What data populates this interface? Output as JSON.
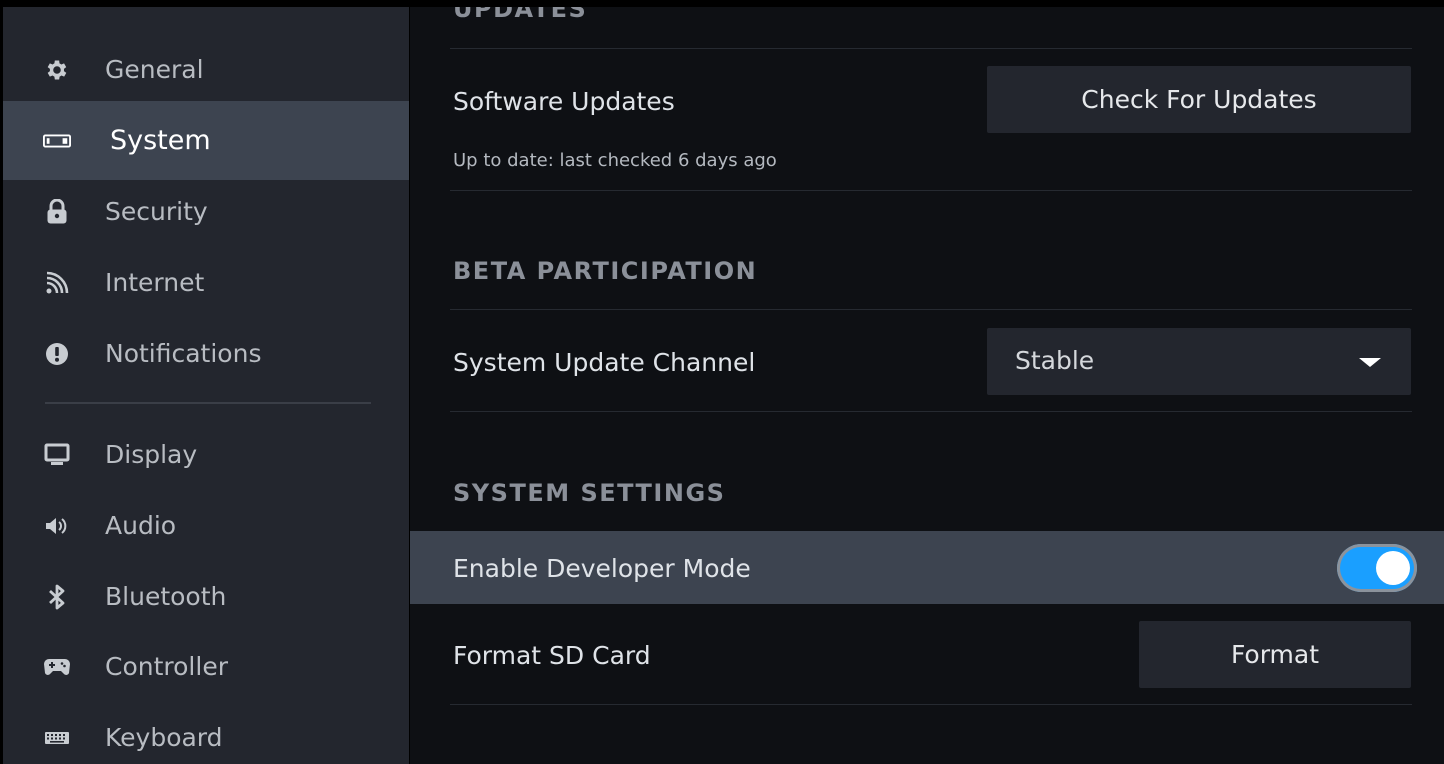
{
  "sidebar": {
    "items": [
      {
        "label": "General",
        "icon": "gear-icon",
        "active": false
      },
      {
        "label": "System",
        "icon": "system-icon",
        "active": true
      },
      {
        "label": "Security",
        "icon": "lock-icon",
        "active": false
      },
      {
        "label": "Internet",
        "icon": "wifi-icon",
        "active": false
      },
      {
        "label": "Notifications",
        "icon": "alert-icon",
        "active": false
      },
      {
        "label": "Display",
        "icon": "monitor-icon",
        "active": false
      },
      {
        "label": "Audio",
        "icon": "speaker-icon",
        "active": false
      },
      {
        "label": "Bluetooth",
        "icon": "bluetooth-icon",
        "active": false
      },
      {
        "label": "Controller",
        "icon": "gamepad-icon",
        "active": false
      },
      {
        "label": "Keyboard",
        "icon": "keyboard-icon",
        "active": false
      }
    ]
  },
  "main": {
    "updates": {
      "title": "UPDATES",
      "software_label": "Software Updates",
      "status": "Up to date: last checked 6 days ago",
      "check_button": "Check For Updates"
    },
    "beta": {
      "title": "BETA PARTICIPATION",
      "channel_label": "System Update Channel",
      "channel_value": "Stable"
    },
    "system_settings": {
      "title": "SYSTEM SETTINGS",
      "dev_mode_label": "Enable Developer Mode",
      "dev_mode_enabled": true,
      "format_label": "Format SD Card",
      "format_button": "Format"
    }
  },
  "colors": {
    "accent": "#1a9fff",
    "sidebar_bg": "#23262e",
    "highlight_bg": "#3d4450",
    "content_bg": "#0e1014"
  }
}
